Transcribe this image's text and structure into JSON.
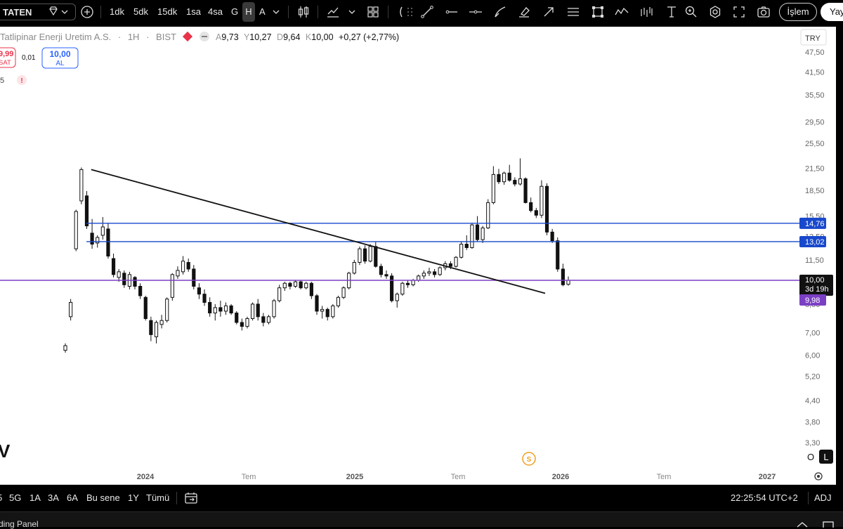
{
  "toolbar": {
    "symbol": "TATEN",
    "intervals": [
      "1dk",
      "5dk",
      "15dk",
      "1sa",
      "4sa",
      "G",
      "H",
      "A"
    ],
    "active_interval": "H",
    "trade_button": "İşlem",
    "publish_button": "Yay"
  },
  "legend": {
    "name": "Tatlipinar Enerji Uretim A.S.",
    "interval": "1H",
    "exchange": "BIST",
    "open_label": "A",
    "open_value": "9,73",
    "high_label": "Y",
    "high_value": "10,27",
    "low_label": "D",
    "low_value": "9,64",
    "close_label": "K",
    "close_value": "10,00",
    "change": "+0,27 (+2,77%)",
    "sell_price": "9,99",
    "sell_label": "SAT",
    "spread": "0,01",
    "buy_price": "10,00",
    "buy_label": "AL",
    "indicator_count": "5",
    "alert_mark": "!"
  },
  "price_axis": {
    "currency": "TRY",
    "ticks": [
      "47,50",
      "41,50",
      "35,50",
      "29,50",
      "25,50",
      "21,50",
      "18,50",
      "15,50",
      "13,50",
      "11,50",
      "8,50",
      "7,00",
      "6,00",
      "5,20",
      "4,40",
      "3,80",
      "3,30"
    ],
    "lines": [
      {
        "label": "14,76",
        "color": "#1848cc"
      },
      {
        "label": "13,02",
        "color": "#1848cc"
      }
    ],
    "current_price": "10,00",
    "countdown": "3d 19h",
    "purple_label": "9,98",
    "purple_color": "#7b3fc4"
  },
  "time_axis": {
    "labels": [
      {
        "text": "2024",
        "bold": true
      },
      {
        "text": "Tem",
        "bold": false
      },
      {
        "text": "2025",
        "bold": true
      },
      {
        "text": "Tem",
        "bold": false
      },
      {
        "text": "2026",
        "bold": true
      },
      {
        "text": "Tem",
        "bold": false
      },
      {
        "text": "2027",
        "bold": true
      }
    ]
  },
  "chart_extras": {
    "dividend_mark": "S",
    "scale_o": "O",
    "scale_l": "L",
    "logo_glyph": "V"
  },
  "bottom": {
    "ranges": [
      "5G",
      "1A",
      "3A",
      "6A",
      "Bu sene",
      "1Y",
      "Tümü"
    ],
    "clock": "22:25:54 UTC+2",
    "adj": "ADJ",
    "panel_tab": "ding Panel"
  },
  "chart_data": {
    "type": "candlestick",
    "title": "",
    "y_scale": "log",
    "ylim": [
      3.1,
      50
    ],
    "candles": [
      [
        6.2,
        6.5,
        6.1,
        6.4
      ],
      [
        7.8,
        8.8,
        7.6,
        8.6
      ],
      [
        12.4,
        16.2,
        12.2,
        16.0
      ],
      [
        17.2,
        21.6,
        16.8,
        21.3
      ],
      [
        17.8,
        18.4,
        14.2,
        14.5
      ],
      [
        13.8,
        15.2,
        12.4,
        12.8
      ],
      [
        12.9,
        13.6,
        12.5,
        13.4
      ],
      [
        13.6,
        15.4,
        13.2,
        14.4
      ],
      [
        14.2,
        14.8,
        11.6,
        11.8
      ],
      [
        11.6,
        12.0,
        10.2,
        10.4
      ],
      [
        10.2,
        10.8,
        9.9,
        10.6
      ],
      [
        10.5,
        10.7,
        9.5,
        9.7
      ],
      [
        9.6,
        10.6,
        9.4,
        10.4
      ],
      [
        10.2,
        10.3,
        9.4,
        9.6
      ],
      [
        9.6,
        9.8,
        8.8,
        9.0
      ],
      [
        8.9,
        9.0,
        7.6,
        7.7
      ],
      [
        7.6,
        7.8,
        6.6,
        6.9
      ],
      [
        6.8,
        7.6,
        6.5,
        7.5
      ],
      [
        7.4,
        7.9,
        7.2,
        7.6
      ],
      [
        7.6,
        8.9,
        7.5,
        8.8
      ],
      [
        8.9,
        10.5,
        8.7,
        10.4
      ],
      [
        10.3,
        11.0,
        10.1,
        10.7
      ],
      [
        10.6,
        11.8,
        10.4,
        11.4
      ],
      [
        11.3,
        11.6,
        10.6,
        10.8
      ],
      [
        10.8,
        11.1,
        9.4,
        9.6
      ],
      [
        9.5,
        9.8,
        8.8,
        9.1
      ],
      [
        9.1,
        9.4,
        8.4,
        8.6
      ],
      [
        8.6,
        8.9,
        7.8,
        8.0
      ],
      [
        8.0,
        8.5,
        7.6,
        8.3
      ],
      [
        8.3,
        8.7,
        7.8,
        8.1
      ],
      [
        8.1,
        8.6,
        7.9,
        8.4
      ],
      [
        8.4,
        8.5,
        7.9,
        8.0
      ],
      [
        8.0,
        8.1,
        7.4,
        7.5
      ],
      [
        7.5,
        7.7,
        7.1,
        7.3
      ],
      [
        7.3,
        7.8,
        7.2,
        7.7
      ],
      [
        7.7,
        8.6,
        7.6,
        8.5
      ],
      [
        8.5,
        8.8,
        7.6,
        7.8
      ],
      [
        7.8,
        8.0,
        7.3,
        7.5
      ],
      [
        7.5,
        7.9,
        7.4,
        7.8
      ],
      [
        7.8,
        8.8,
        7.7,
        8.7
      ],
      [
        8.7,
        9.7,
        8.6,
        9.5
      ],
      [
        9.5,
        9.9,
        9.3,
        9.8
      ],
      [
        9.8,
        9.9,
        9.4,
        9.6
      ],
      [
        9.6,
        10.0,
        9.5,
        9.9
      ],
      [
        9.9,
        10.0,
        9.4,
        9.5
      ],
      [
        9.5,
        9.9,
        9.4,
        9.8
      ],
      [
        9.8,
        9.9,
        8.8,
        9.0
      ],
      [
        9.0,
        9.1,
        7.9,
        8.1
      ],
      [
        8.1,
        8.4,
        7.7,
        8.2
      ],
      [
        8.2,
        8.3,
        7.6,
        7.8
      ],
      [
        7.8,
        8.5,
        7.7,
        8.4
      ],
      [
        8.4,
        9.0,
        8.3,
        8.9
      ],
      [
        8.9,
        9.6,
        8.8,
        9.5
      ],
      [
        9.5,
        10.6,
        9.4,
        10.5
      ],
      [
        10.5,
        11.5,
        10.4,
        11.3
      ],
      [
        11.3,
        12.6,
        11.1,
        12.4
      ],
      [
        12.4,
        12.7,
        11.2,
        11.4
      ],
      [
        11.4,
        12.8,
        11.3,
        12.6
      ],
      [
        12.6,
        13.0,
        10.9,
        11.0
      ],
      [
        11.0,
        11.2,
        10.2,
        10.4
      ],
      [
        10.4,
        10.7,
        10.1,
        10.3
      ],
      [
        10.3,
        10.5,
        8.6,
        8.7
      ],
      [
        8.7,
        9.2,
        8.3,
        9.1
      ],
      [
        9.1,
        9.9,
        9.0,
        9.8
      ],
      [
        9.8,
        10.0,
        9.5,
        9.7
      ],
      [
        9.7,
        10.1,
        9.6,
        10.0
      ],
      [
        10.0,
        10.4,
        9.9,
        10.3
      ],
      [
        10.3,
        10.7,
        10.1,
        10.5
      ],
      [
        10.5,
        10.9,
        10.3,
        10.6
      ],
      [
        10.6,
        10.8,
        10.2,
        10.4
      ],
      [
        10.4,
        11.0,
        10.3,
        10.9
      ],
      [
        10.9,
        11.4,
        10.7,
        11.2
      ],
      [
        11.2,
        11.4,
        10.8,
        11.0
      ],
      [
        11.0,
        11.8,
        10.9,
        11.7
      ],
      [
        11.7,
        13.0,
        11.6,
        12.8
      ],
      [
        12.8,
        13.6,
        12.3,
        12.5
      ],
      [
        12.5,
        14.8,
        12.4,
        14.6
      ],
      [
        14.6,
        15.5,
        13.0,
        13.2
      ],
      [
        13.2,
        14.5,
        12.9,
        14.3
      ],
      [
        14.3,
        17.4,
        14.2,
        17.0
      ],
      [
        17.0,
        21.8,
        16.8,
        20.6
      ],
      [
        20.6,
        21.4,
        19.3,
        19.6
      ],
      [
        19.6,
        21.0,
        19.2,
        20.8
      ],
      [
        20.8,
        22.0,
        19.6,
        19.8
      ],
      [
        19.8,
        20.2,
        19.0,
        19.3
      ],
      [
        19.3,
        23.0,
        19.1,
        20.0
      ],
      [
        20.0,
        20.2,
        16.9,
        17.0
      ],
      [
        17.0,
        17.6,
        15.9,
        16.1
      ],
      [
        16.1,
        16.4,
        15.3,
        15.6
      ],
      [
        15.6,
        19.8,
        15.3,
        19.0
      ],
      [
        19.0,
        19.4,
        13.6,
        13.9
      ],
      [
        13.9,
        14.2,
        12.9,
        13.1
      ],
      [
        13.1,
        13.4,
        10.6,
        10.8
      ],
      [
        10.8,
        11.2,
        9.6,
        9.7
      ],
      [
        9.73,
        10.27,
        9.64,
        10.0
      ]
    ],
    "horizontal_lines": [
      {
        "value": 14.76,
        "color": "#1848cc"
      },
      {
        "value": 13.02,
        "color": "#1848cc"
      },
      {
        "value": 10.0,
        "color": "#7b3fc4"
      }
    ],
    "trend_line": {
      "from": [
        3,
        21.3
      ],
      "to": [
        94,
        9.6
      ],
      "color": "#111111"
    }
  }
}
